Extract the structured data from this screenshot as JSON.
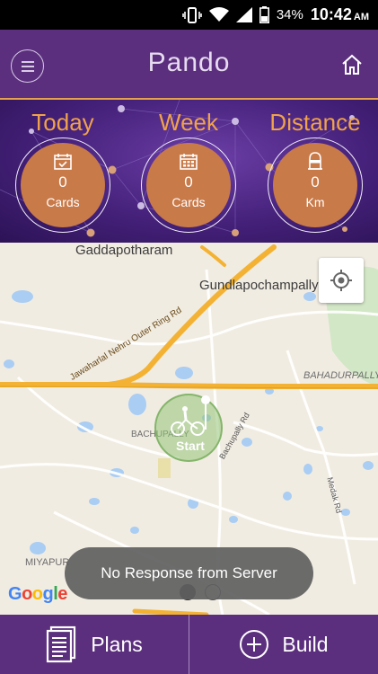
{
  "status_bar": {
    "battery_percent": "34%",
    "time": "10:42",
    "ampm": "AM",
    "icons": [
      "vibrate-icon",
      "wifi-icon",
      "signal-icon",
      "battery-icon"
    ]
  },
  "app_bar": {
    "title": "Pando",
    "menu_icon": "menu-icon",
    "home_icon": "home-icon"
  },
  "stats": [
    {
      "label": "Today",
      "icon": "calendar-check-icon",
      "value": "0",
      "unit": "Cards"
    },
    {
      "label": "Week",
      "icon": "calendar-grid-icon",
      "value": "0",
      "unit": "Cards"
    },
    {
      "label": "Distance",
      "icon": "milestone-icon",
      "value": "0",
      "unit": "Km"
    }
  ],
  "map": {
    "labels": {
      "gaddapotharam": "Gaddapotharam",
      "gundlapochampally": "Gundlapochampally",
      "bahadurpally": "BAHADURPALLY",
      "ring_road": "Jawaharlal Nehru Outer Ring Rd",
      "bachupally": "BACHUPALLY",
      "bachupally_rd": "Bachupally Rd",
      "medak_rd": "Medak Rd",
      "miyapur": "MIYAPUR"
    },
    "start_label": "Start",
    "google": "Google",
    "toast": "No Response from Server",
    "colors": {
      "land": "#f1ece2",
      "water": "#a9cdf3",
      "road_major": "#f3b233",
      "road_minor": "#ffffff",
      "park": "#cfe5c4"
    }
  },
  "bottom_bar": {
    "plans_label": "Plans",
    "build_label": "Build"
  },
  "theme": {
    "primary": "#5b2f7e",
    "accent": "#f0a24a",
    "circle": "#c97a49"
  }
}
